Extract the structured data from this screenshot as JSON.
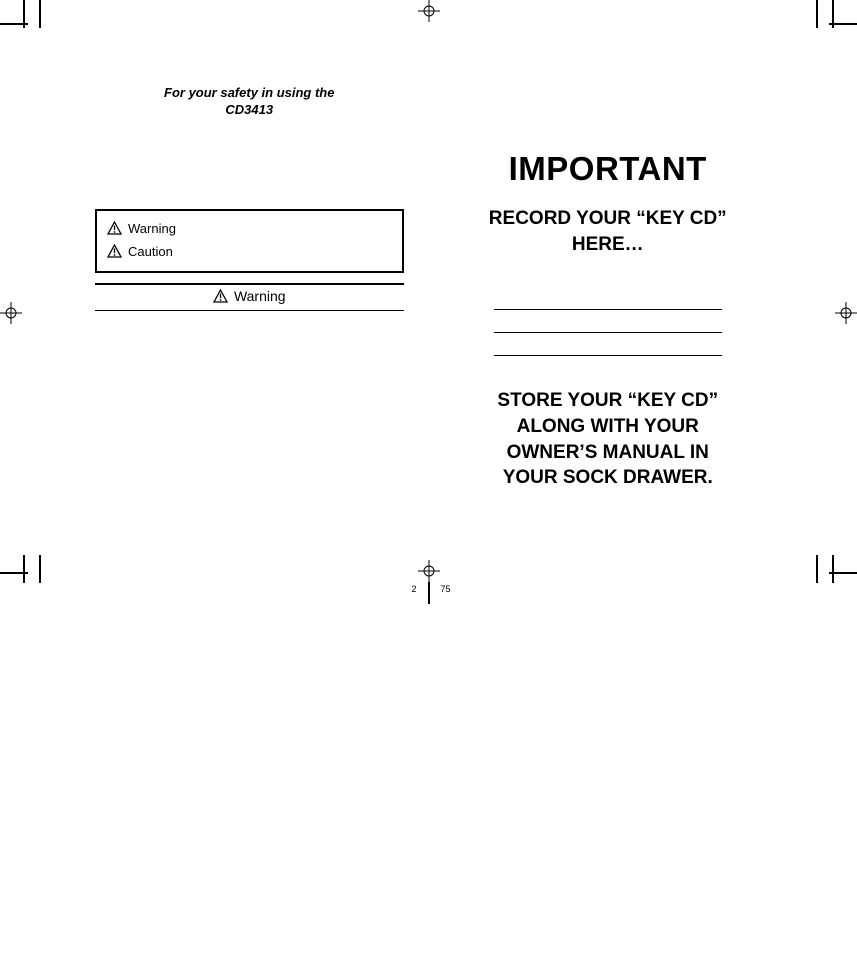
{
  "left": {
    "heading_line1": "For your safety in using the",
    "heading_line2": "CD3413",
    "box_warning": "Warning",
    "box_caution": "Caution",
    "bar_warning": "Warning",
    "page_number": "2"
  },
  "right": {
    "important": "IMPORTANT",
    "record_line1": "RECORD YOUR “KEY CD”",
    "record_line2": "HERE…",
    "store_line1": "STORE YOUR “KEY CD”",
    "store_line2": "ALONG WITH YOUR",
    "store_line3": "OWNER’S MANUAL IN",
    "store_line4": "YOUR SOCK DRAWER.",
    "page_number": "75"
  }
}
